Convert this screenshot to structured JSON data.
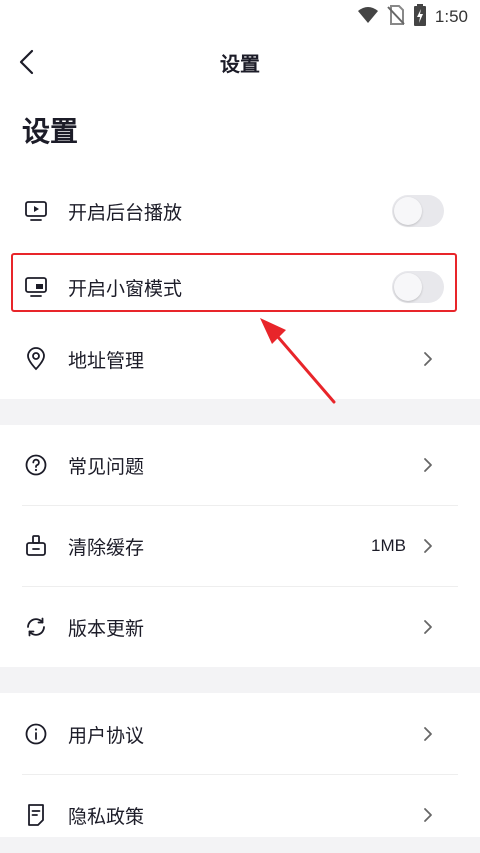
{
  "status_bar": {
    "time": "1:50"
  },
  "nav": {
    "title": "设置"
  },
  "page": {
    "heading": "设置"
  },
  "section1": {
    "background_play": {
      "label": "开启后台播放",
      "enabled": false
    },
    "small_window": {
      "label": "开启小窗模式",
      "enabled": false
    },
    "address": {
      "label": "地址管理"
    }
  },
  "section2": {
    "faq": {
      "label": "常见问题"
    },
    "clear_cache": {
      "label": "清除缓存",
      "value": "1MB"
    },
    "version_update": {
      "label": "版本更新"
    }
  },
  "section3": {
    "user_agreement": {
      "label": "用户协议"
    },
    "privacy_policy": {
      "label": "隐私政策"
    }
  },
  "colors": {
    "annotation": "#e8252a",
    "text": "#1c1c28",
    "toggle_off": "#e8e8ec"
  }
}
